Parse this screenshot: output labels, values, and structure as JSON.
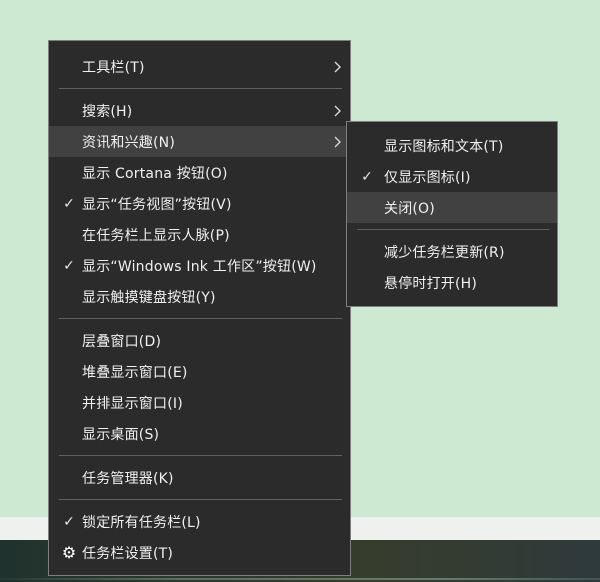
{
  "wallpaper": {
    "top_color": "#cde9d1",
    "light_band_color": "#eef1ee",
    "dark_band_colors": [
      "#20322e",
      "#2c372e",
      "#373d2c",
      "#2e3a3c"
    ]
  },
  "colors": {
    "menu_background": "#2b2b2b",
    "menu_border": "#7f7f7f",
    "menu_highlight": "#414141",
    "menu_text": "#f0f0f0",
    "separator": "#606060"
  },
  "icons": {
    "checkmark": "✓",
    "gear": "⚙"
  },
  "main_menu": {
    "items": [
      {
        "label": "工具栏(T)",
        "has_submenu": true
      },
      {
        "label": "搜索(H)",
        "has_submenu": true
      },
      {
        "label": "资讯和兴趣(N)",
        "has_submenu": true,
        "highlighted": true
      },
      {
        "label": "显示 Cortana 按钮(O)"
      },
      {
        "label": "显示“任务视图”按钮(V)",
        "checked": true
      },
      {
        "label": "在任务栏上显示人脉(P)"
      },
      {
        "label": "显示“Windows Ink 工作区”按钮(W)",
        "checked": true
      },
      {
        "label": "显示触摸键盘按钮(Y)"
      },
      {
        "label": "层叠窗口(D)"
      },
      {
        "label": "堆叠显示窗口(E)"
      },
      {
        "label": "并排显示窗口(I)"
      },
      {
        "label": "显示桌面(S)"
      },
      {
        "label": "任务管理器(K)"
      },
      {
        "label": "锁定所有任务栏(L)",
        "checked": true
      },
      {
        "label": "任务栏设置(T)",
        "has_gear_icon": true
      }
    ]
  },
  "submenu": {
    "items": [
      {
        "label": "显示图标和文本(T)"
      },
      {
        "label": "仅显示图标(I)",
        "checked": true
      },
      {
        "label": "关闭(O)",
        "highlighted": true
      },
      {
        "label": "减少任务栏更新(R)"
      },
      {
        "label": "悬停时打开(H)"
      }
    ]
  }
}
